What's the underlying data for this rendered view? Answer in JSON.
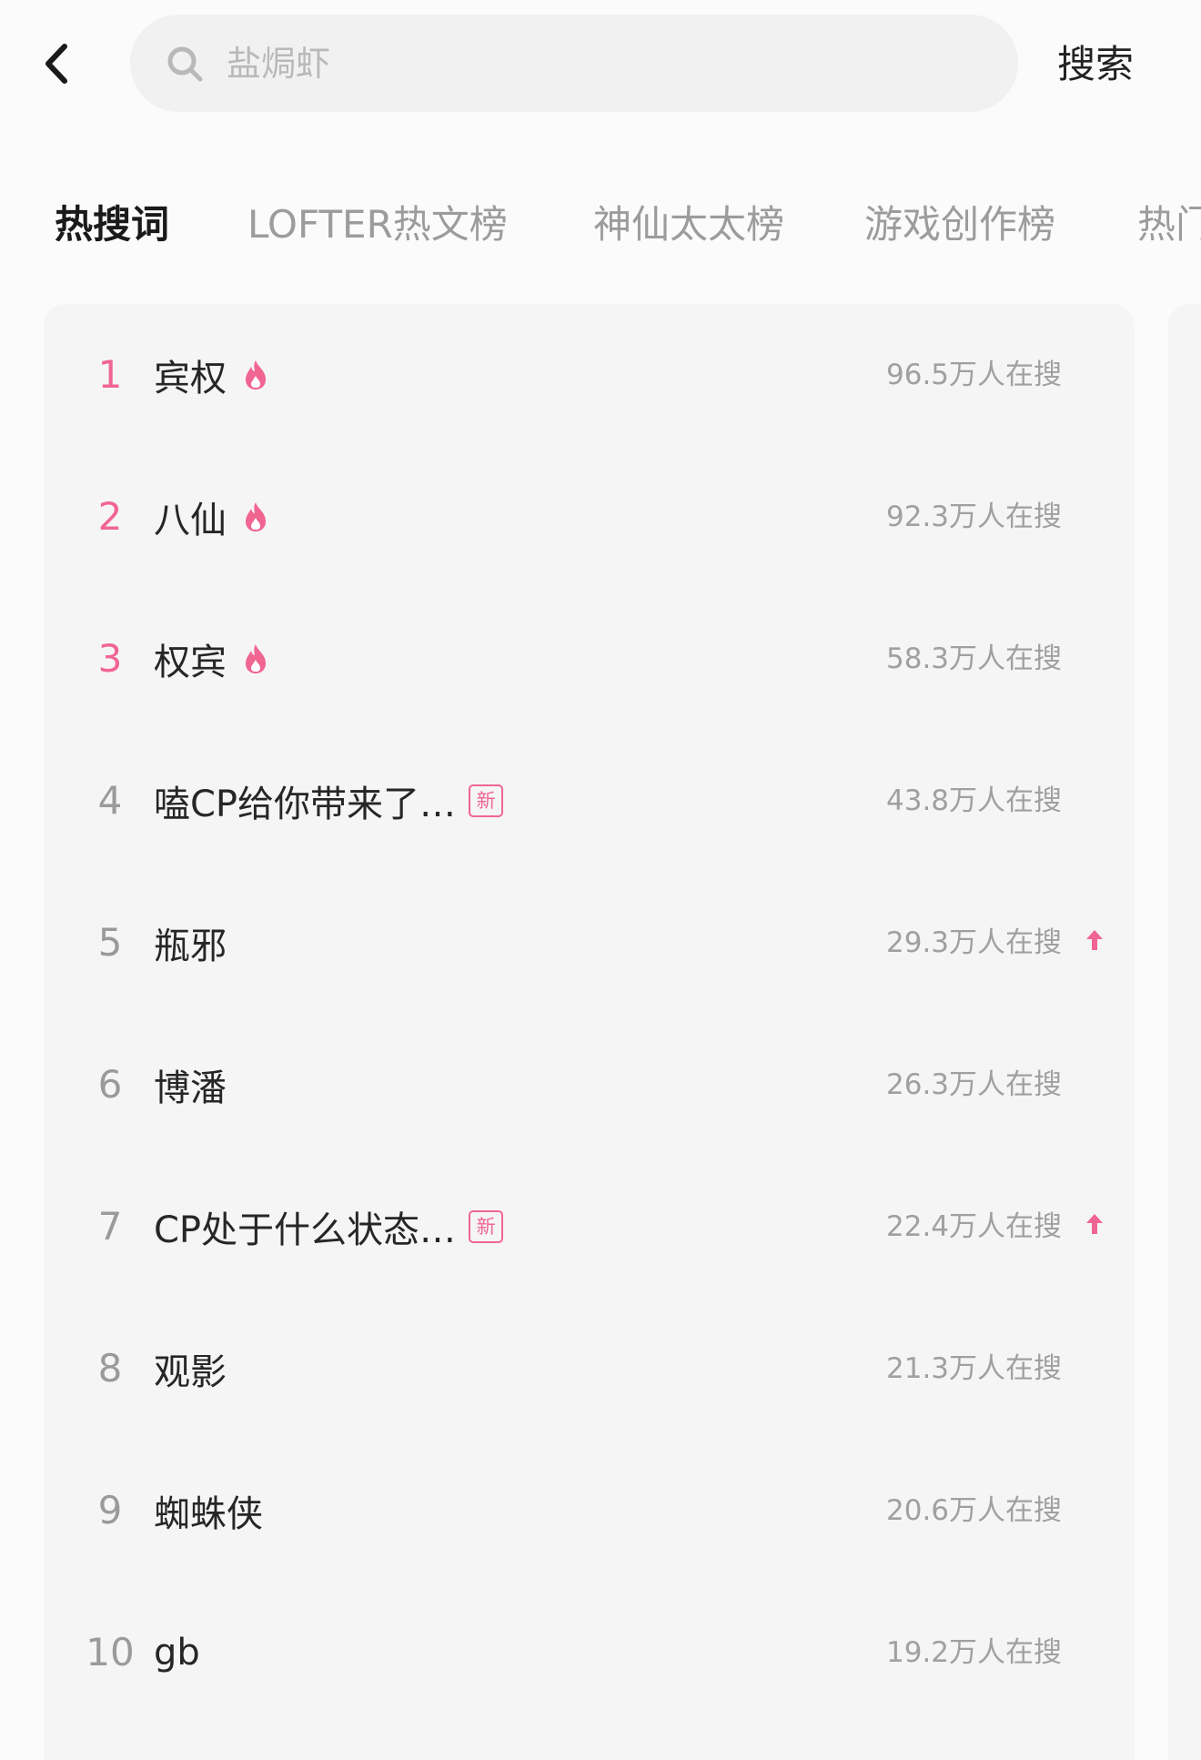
{
  "header": {
    "back_icon": "chevron-left-icon",
    "search_placeholder": "盐焗虾",
    "search_icon": "search-icon",
    "search_button_label": "搜索"
  },
  "tabs": [
    {
      "label": "热搜词",
      "active": true
    },
    {
      "label": "LOFTER热文榜",
      "active": false
    },
    {
      "label": "神仙太太榜",
      "active": false
    },
    {
      "label": "游戏创作榜",
      "active": false
    },
    {
      "label": "热门",
      "active": false
    }
  ],
  "hot_list": [
    {
      "rank": "1",
      "term": "宾权",
      "count": "96.5万人在搜",
      "badge": "fire-icon",
      "trend": ""
    },
    {
      "rank": "2",
      "term": "八仙",
      "count": "92.3万人在搜",
      "badge": "fire-icon",
      "trend": ""
    },
    {
      "rank": "3",
      "term": "权宾",
      "count": "58.3万人在搜",
      "badge": "fire-icon",
      "trend": ""
    },
    {
      "rank": "4",
      "term": "嗑CP给你带来了…",
      "count": "43.8万人在搜",
      "badge": "new",
      "badge_label": "新",
      "trend": ""
    },
    {
      "rank": "5",
      "term": "瓶邪",
      "count": "29.3万人在搜",
      "badge": "",
      "trend": "arrow-up-icon"
    },
    {
      "rank": "6",
      "term": "博潘",
      "count": "26.3万人在搜",
      "badge": "",
      "trend": ""
    },
    {
      "rank": "7",
      "term": "CP处于什么状态…",
      "count": "22.4万人在搜",
      "badge": "new",
      "badge_label": "新",
      "trend": "arrow-up-icon"
    },
    {
      "rank": "8",
      "term": "观影",
      "count": "21.3万人在搜",
      "badge": "",
      "trend": ""
    },
    {
      "rank": "9",
      "term": "蜘蛛侠",
      "count": "20.6万人在搜",
      "badge": "",
      "trend": ""
    },
    {
      "rank": "10",
      "term": "gb",
      "count": "19.2万人在搜",
      "badge": "",
      "trend": ""
    }
  ],
  "colors": {
    "accent_pink": "#f06592",
    "rank_gray": "#9a9a9a",
    "card_bg": "#f5f5f5"
  }
}
